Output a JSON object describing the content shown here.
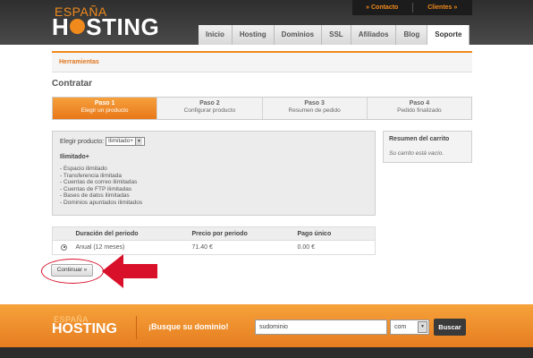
{
  "header": {
    "logo_top": "ESPAÑA",
    "logo_main_a": "H",
    "logo_main_b": "STING",
    "topbar": {
      "contact": "» Contacto",
      "clients": "Clientes »"
    },
    "nav": [
      "Inicio",
      "Hosting",
      "Dominios",
      "SSL",
      "Afiliados",
      "Blog",
      "Soporte"
    ],
    "nav_active": "Soporte"
  },
  "breadcrumb": "Herramientas",
  "page_title": "Contratar",
  "steps": [
    {
      "number": "Paso 1",
      "desc": "Elegir un producto",
      "active": true
    },
    {
      "number": "Paso 2",
      "desc": "Configurar producto",
      "active": false
    },
    {
      "number": "Paso 3",
      "desc": "Resumen de pedido",
      "active": false
    },
    {
      "number": "Paso 4",
      "desc": "Pedido finalizado",
      "active": false
    }
  ],
  "product": {
    "label": "Elegir producto:",
    "selected": "Ilimitado+",
    "name": "Ilimitado+",
    "features": [
      "- Espacio ilimitado",
      "- Transferencia ilimitada",
      "- Cuentas de correo ilimitadas",
      "- Cuentas de FTP ilimitadas",
      "- Bases de datos ilimitadas",
      "- Dominios apuntados ilimitados"
    ]
  },
  "cart": {
    "title": "Resumen del carrito",
    "empty": "Su carrito está vacío."
  },
  "pricing": {
    "headers": [
      "Duración del periodo",
      "Precio por periodo",
      "Pago único"
    ],
    "row": {
      "duration": "Anual (12 meses)",
      "price": "71.40 €",
      "setup": "0.00 €"
    }
  },
  "continue_label": "Continuar »",
  "footer": {
    "logo_top": "ESPAÑA",
    "logo_main": "HOSTING",
    "heading": "¡Busque su dominio!",
    "domain_value": "sudominio",
    "tld_value": "com",
    "search_label": "Buscar"
  },
  "colors": {
    "accent": "#f08a1c",
    "highlight": "#d8102a",
    "dark": "#2e2e2e"
  }
}
